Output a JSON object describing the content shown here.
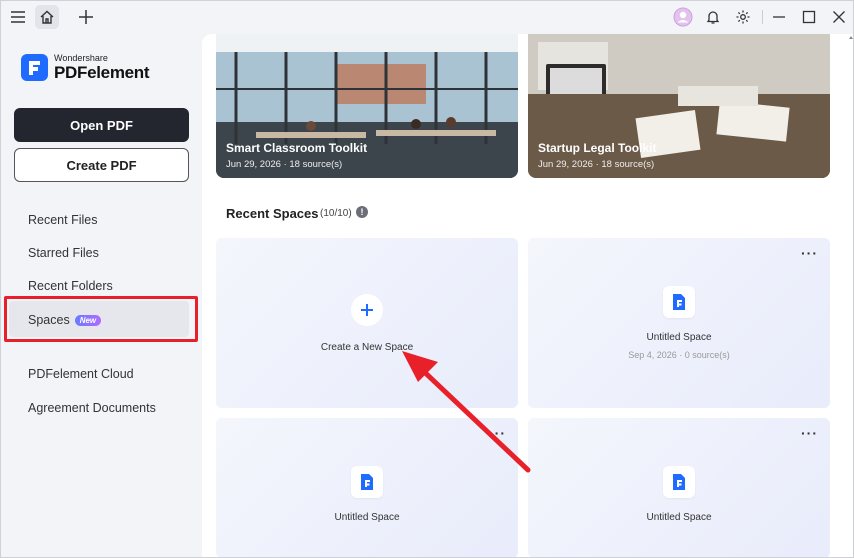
{
  "titlebar": {
    "icons": [
      "menu-icon",
      "home-icon",
      "plus-icon",
      "avatar",
      "bell-icon",
      "gear-icon",
      "minimize-icon",
      "maximize-icon",
      "close-icon"
    ]
  },
  "sidebar": {
    "logo_brand": "Wondershare",
    "logo_name": "PDFelement",
    "open_pdf": "Open PDF",
    "create_pdf": "Create PDF",
    "items": [
      {
        "label": "Recent Files"
      },
      {
        "label": "Starred Files"
      },
      {
        "label": "Recent Folders"
      },
      {
        "label": "Spaces",
        "badge": "New",
        "active": true
      },
      {
        "label": "PDFelement Cloud"
      },
      {
        "label": "Agreement Documents"
      }
    ]
  },
  "templates": [
    {
      "title": "Smart Classroom Toolkit",
      "subtitle": "Jun 29, 2026 · 18 source(s)"
    },
    {
      "title": "Startup Legal Toolkit",
      "subtitle": "Jun 29, 2026 · 18 source(s)"
    }
  ],
  "recent_spaces": {
    "title": "Recent Spaces",
    "count": "(10/10)",
    "create_label": "Create a New Space",
    "more_label": "···",
    "cards": [
      {
        "title": "Untitled Space",
        "subtitle": "Sep 4, 2026 · 0 source(s)"
      },
      {
        "title": "Untitled Space"
      },
      {
        "title": "Untitled Space"
      }
    ]
  },
  "colors": {
    "accent": "#1f6bff",
    "highlight_border": "#e8202a",
    "arrow": "#e8202a",
    "primary_button": "#23252f"
  }
}
